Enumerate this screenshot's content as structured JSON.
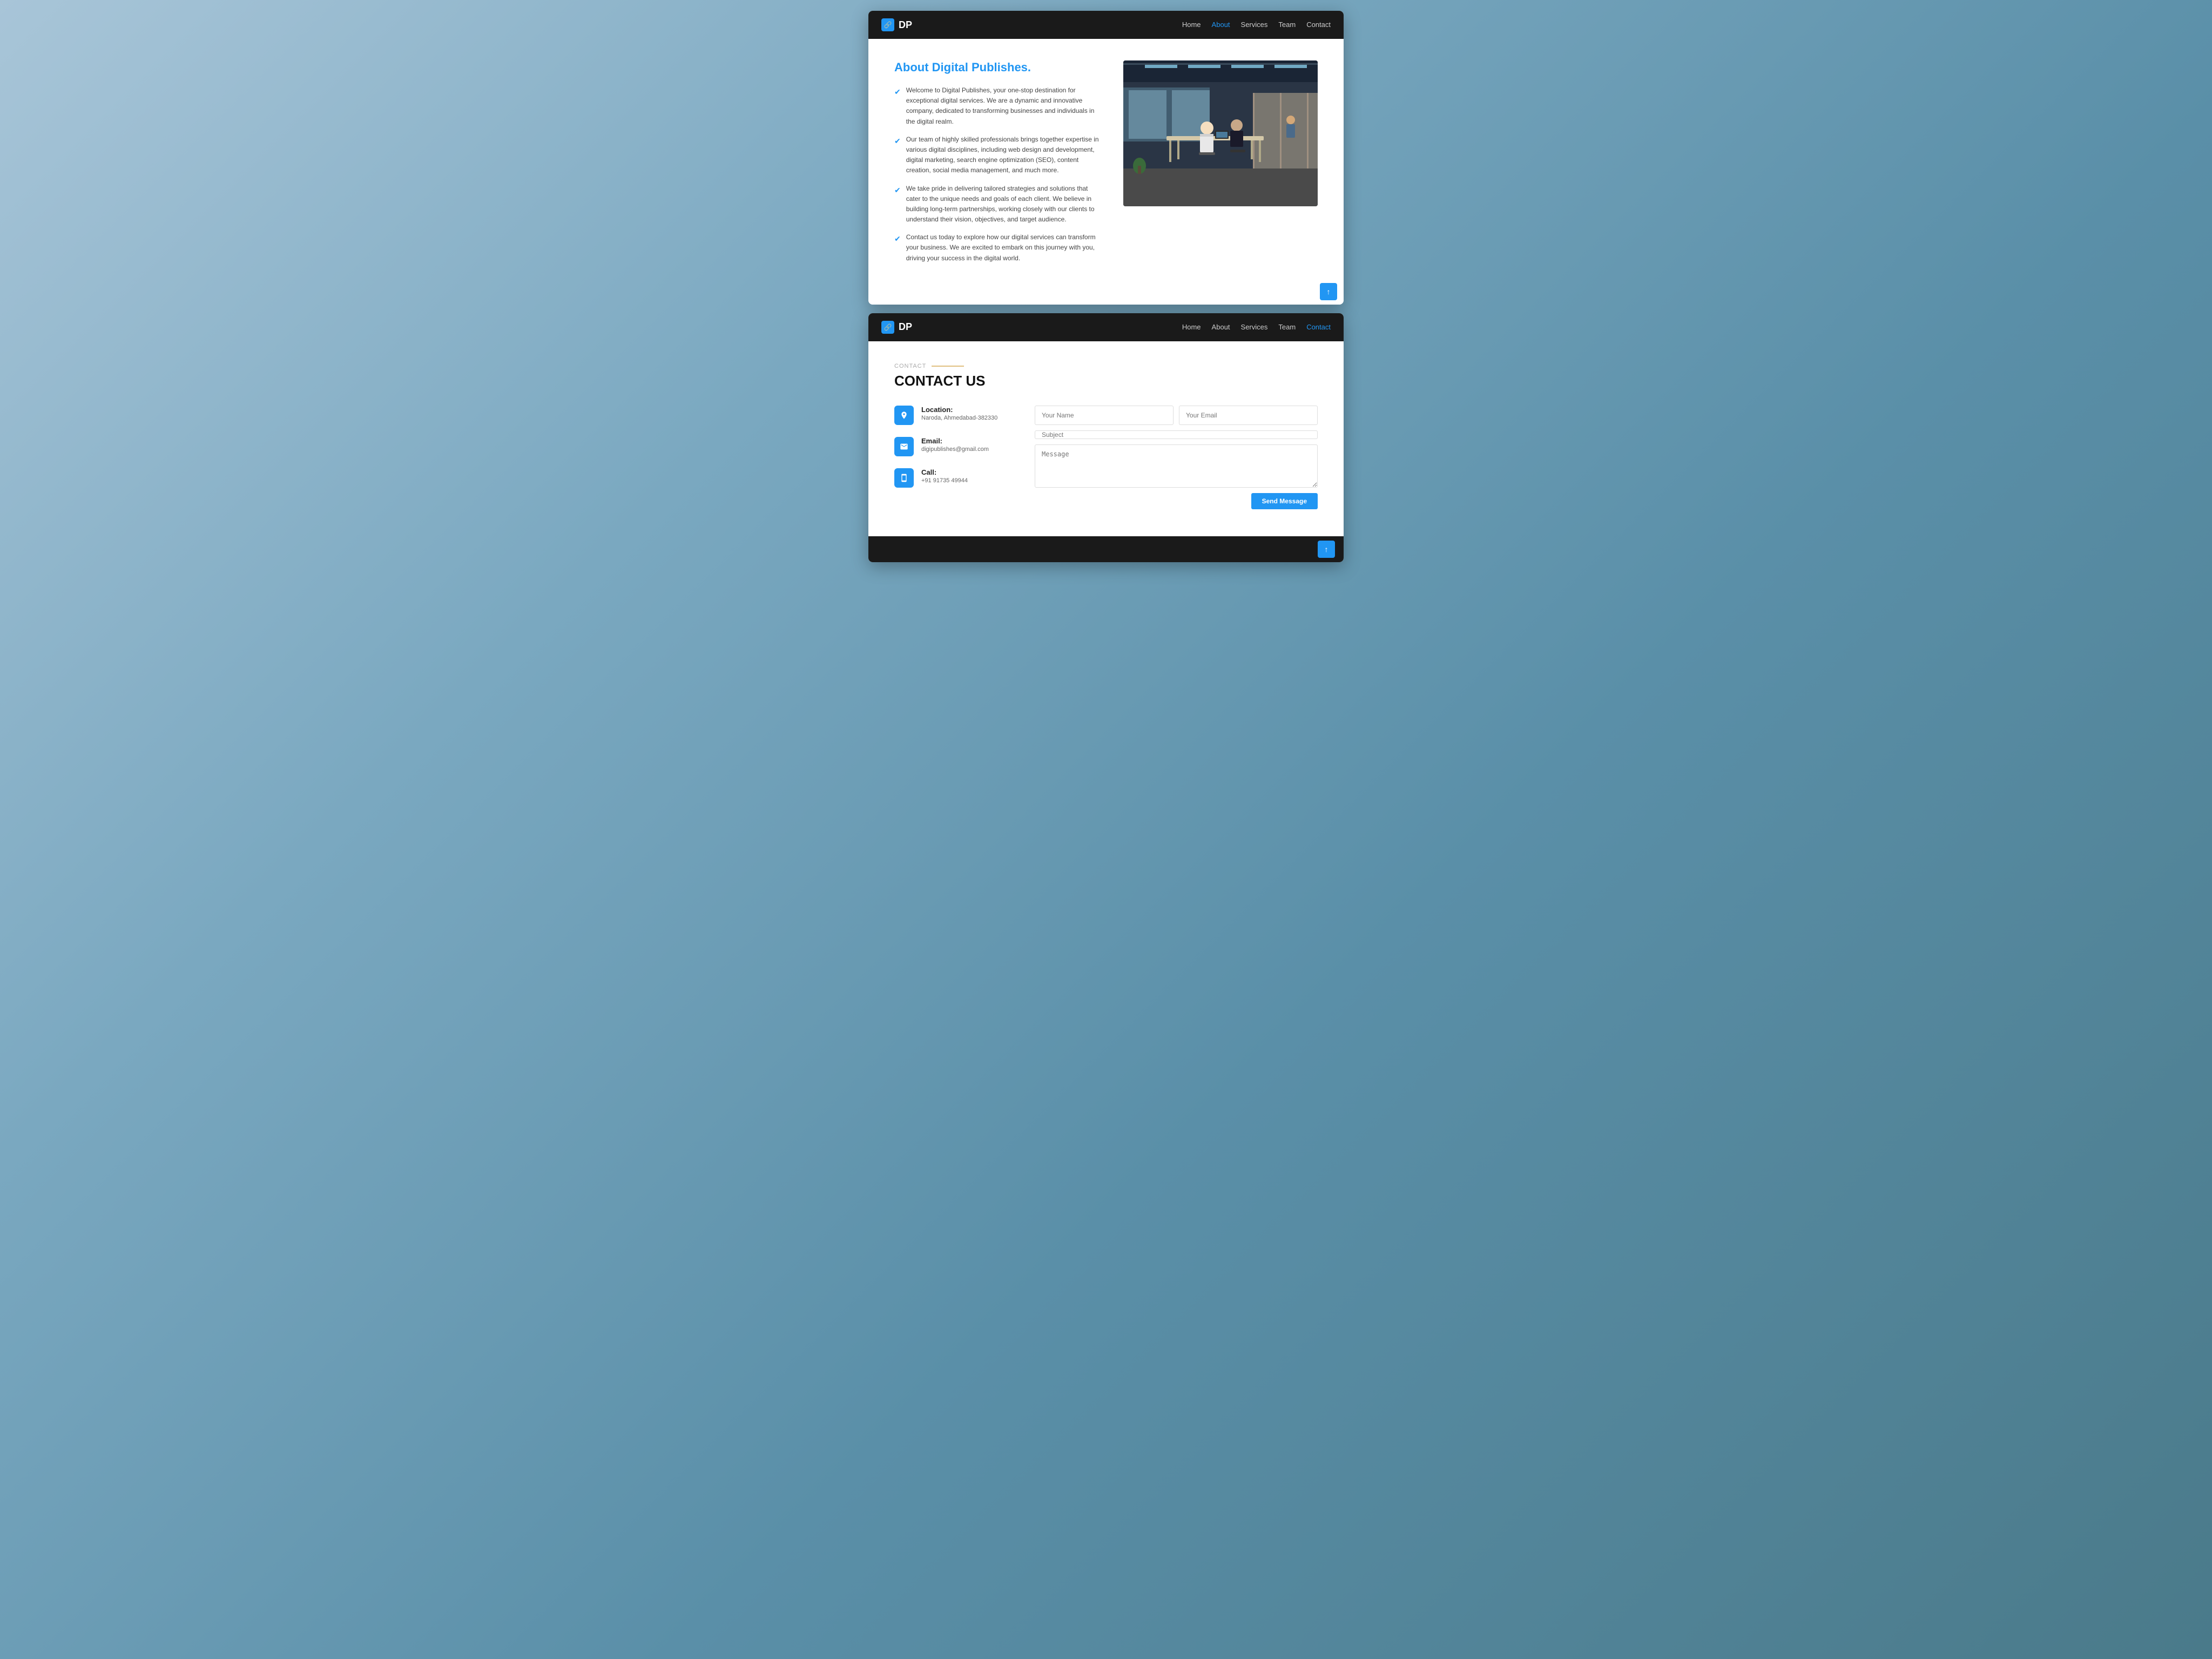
{
  "browser1": {
    "navbar": {
      "brand": "DP",
      "brand_icon": "🔗",
      "nav_items": [
        {
          "label": "Home",
          "active": false
        },
        {
          "label": "About",
          "active": true
        },
        {
          "label": "Services",
          "active": false
        },
        {
          "label": "Team",
          "active": false
        },
        {
          "label": "Contact",
          "active": false
        }
      ]
    },
    "about": {
      "title_prefix": "About ",
      "title_highlight": "Digital Publishes.",
      "paragraphs": [
        "Welcome to Digital Publishes, your one-stop destination for exceptional digital services. We are a dynamic and innovative company, dedicated to transforming businesses and individuals in the digital realm.",
        "Our team of highly skilled professionals brings together expertise in various digital disciplines, including web design and development, digital marketing, search engine optimization (SEO), content creation, social media management, and much more.",
        "We take pride in delivering tailored strategies and solutions that cater to the unique needs and goals of each client. We believe in building long-term partnerships, working closely with our clients to understand their vision, objectives, and target audience.",
        "Contact us today to explore how our digital services can transform your business. We are excited to embark on this journey with you, driving your success in the digital world."
      ]
    }
  },
  "browser2": {
    "navbar": {
      "brand": "DP",
      "brand_icon": "🔗",
      "nav_items": [
        {
          "label": "Home",
          "active": false
        },
        {
          "label": "About",
          "active": false
        },
        {
          "label": "Services",
          "active": false
        },
        {
          "label": "Team",
          "active": false
        },
        {
          "label": "Contact",
          "active": true
        }
      ]
    },
    "contact": {
      "section_label": "CONTACT",
      "section_title": "CONTACT US",
      "info_items": [
        {
          "icon": "📍",
          "title": "Location:",
          "detail": "Naroda, Ahmedabad-382330"
        },
        {
          "icon": "✉",
          "title": "Email:",
          "detail": "digipublishes@gmail.com"
        },
        {
          "icon": "📱",
          "title": "Call:",
          "detail": "+91 91735 49944"
        }
      ],
      "form": {
        "name_placeholder": "Your Name",
        "email_placeholder": "Your Email",
        "subject_placeholder": "Subject",
        "message_placeholder": "Message",
        "send_button": "Send Message"
      }
    }
  }
}
